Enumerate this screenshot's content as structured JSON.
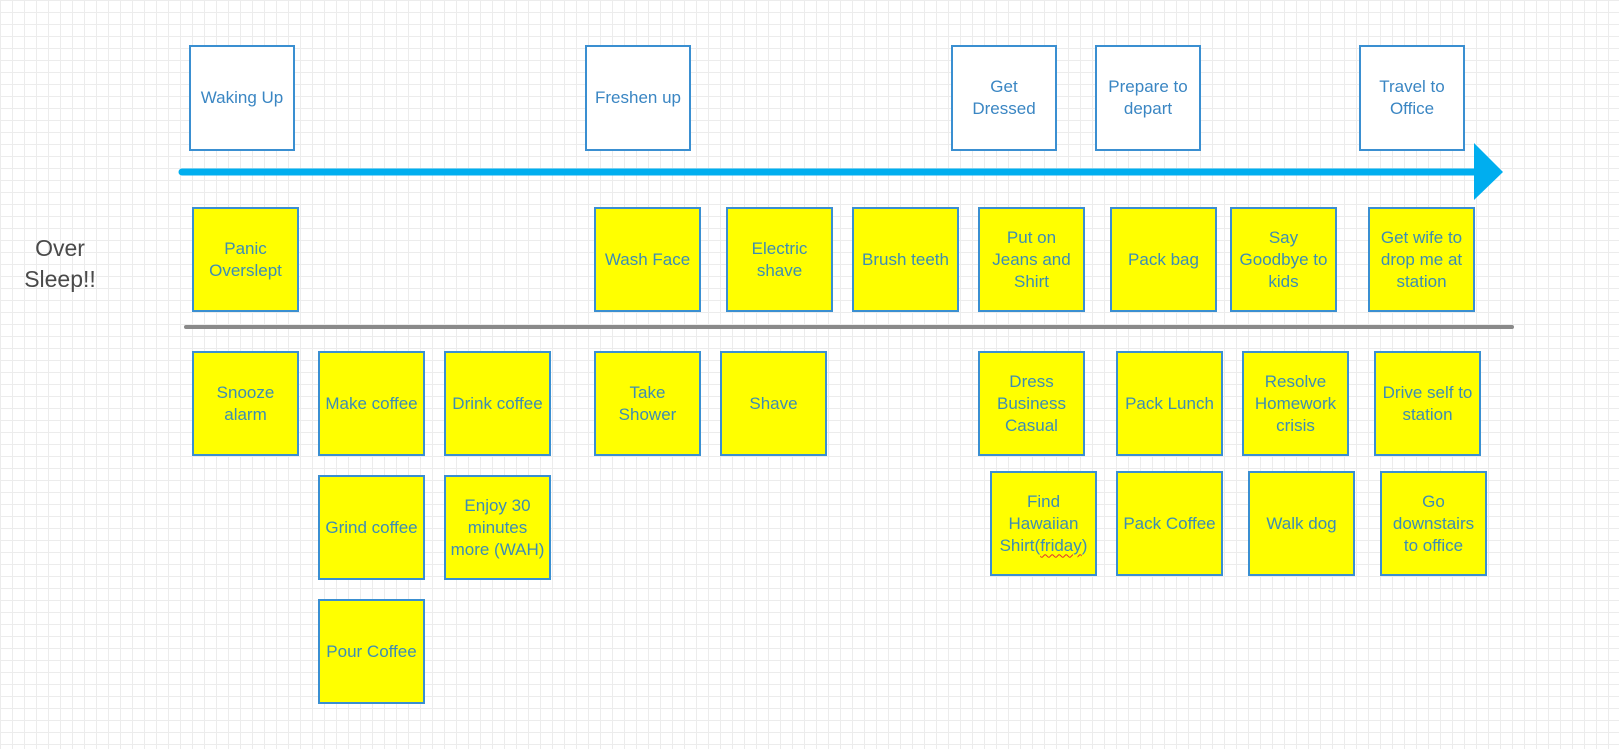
{
  "colors": {
    "timeline_arrow": "#00aeef",
    "divider": "#8a8a8a",
    "note_fill": "#ffff00",
    "box_border": "#3a8fd1",
    "text": "#3a86c3"
  },
  "row_label": "Over Sleep!!",
  "stages": [
    {
      "label": "Waking Up"
    },
    {
      "label": "Freshen up"
    },
    {
      "label": "Get Dressed"
    },
    {
      "label": "Prepare to depart"
    },
    {
      "label": "Travel to Office"
    }
  ],
  "above_line_notes": [
    {
      "label": "Panic Overslept"
    },
    {
      "label": "Wash Face"
    },
    {
      "label": "Electric shave"
    },
    {
      "label": "Brush teeth"
    },
    {
      "label": "Put on Jeans and Shirt"
    },
    {
      "label": "Pack bag"
    },
    {
      "label": "Say Goodbye to kids"
    },
    {
      "label": "Get wife to drop me at station"
    }
  ],
  "below_line_notes": [
    {
      "label": "Snooze alarm"
    },
    {
      "label": "Make coffee"
    },
    {
      "label": "Drink coffee"
    },
    {
      "label": "Take Shower"
    },
    {
      "label": "Shave"
    },
    {
      "label": "Dress Business Casual"
    },
    {
      "label": "Pack Lunch"
    },
    {
      "label": "Resolve Homework crisis"
    },
    {
      "label": "Drive self to station"
    },
    {
      "label": "Grind coffee"
    },
    {
      "label": "Enjoy 30 minutes more (WAH)"
    },
    {
      "label": "Find Hawaiian Shirt(friday)",
      "prefix": "Find Hawaiian Shirt(",
      "misspelled": "friday",
      "suffix": ")"
    },
    {
      "label": "Pack Coffee"
    },
    {
      "label": "Walk dog"
    },
    {
      "label": "Go downstairs to office"
    },
    {
      "label": "Pour Coffee"
    }
  ]
}
